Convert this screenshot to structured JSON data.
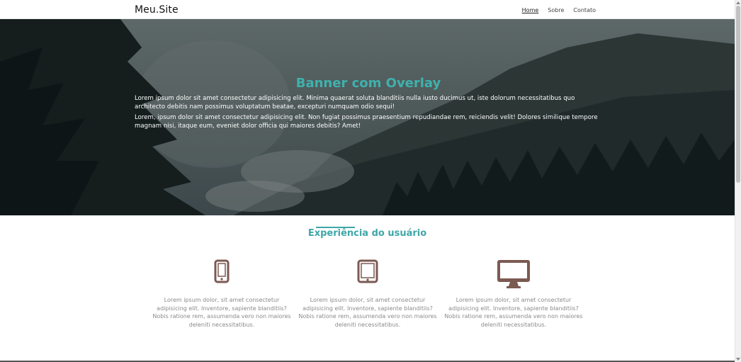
{
  "header": {
    "brand": "Meu.Site",
    "nav": [
      "Home",
      "Sobre",
      "Contato"
    ]
  },
  "banner": {
    "title": "Banner com Overlay",
    "paragraphs": [
      "Lorem ipsum dolor sit amet consectetur adipisicing elit. Minima quaerat soluta blanditiis nulla iusto ducimus ut, iste dolorum necessitatibus quo architecto debitis nam possimus voluptatum beatae, excepturi numquam odio sequi!",
      "Lorem, ipsum dolor sit amet consectetur adipisicing elit. Non fugiat possimus praesentium repudiandae rem, reiciendis velit! Dolores similique tempore magnam nisi, itaque eum, eveniet dolor officia qui maiores debitis? Amet!"
    ]
  },
  "section": {
    "title": "Experiência do usuário",
    "features": [
      {
        "icon": "smartphone-icon",
        "text": "Lorem ipsum dolor, sit amet consectetur adipisicing elit. Inventore, sapiente blanditiis? Nobis ratione rem, assumenda vero non maiores deleniti necessitatibus."
      },
      {
        "icon": "tablet-icon",
        "text": "Lorem ipsum dolor, sit amet consectetur adipisicing elit. Inventore, sapiente blanditiis? Nobis ratione rem, assumenda vero non maiores deleniti necessitatibus."
      },
      {
        "icon": "desktop-icon",
        "text": "Lorem ipsum dolor, sit amet consectetur adipisicing elit. Inventore, sapiente blanditiis? Nobis ratione rem, assumenda vero non maiores deleniti necessitatibus."
      }
    ]
  },
  "colors": {
    "accent": "#3fa6a8",
    "icon": "#7b5a52"
  }
}
